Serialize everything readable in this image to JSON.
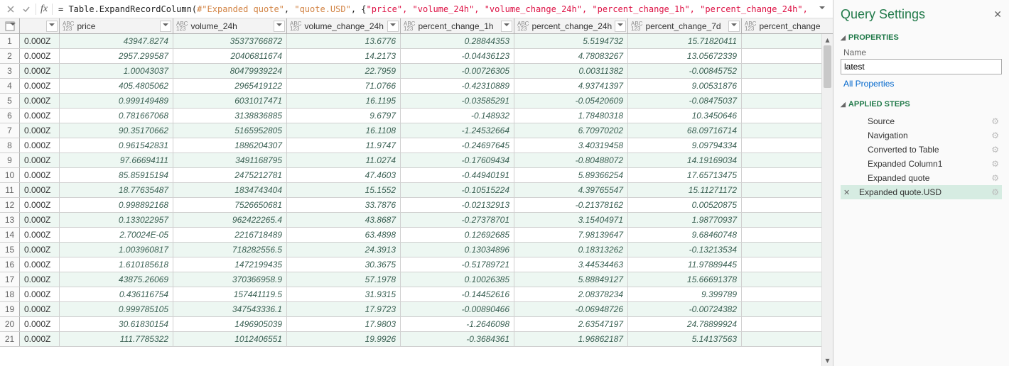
{
  "formula": {
    "prefix": "= Table.ExpandRecordColumn(",
    "arg1": "#\"Expanded quote\"",
    "sep1": ", ",
    "arg2": "\"quote.USD\"",
    "sep2": ", {",
    "cols": "\"price\", \"volume_24h\", \"volume_change_24h\", \"percent_change_1h\", \"percent_change_24h\","
  },
  "columns": {
    "price": "price",
    "volume_24h": "volume_24h",
    "volume_change_24h": "volume_change_24h",
    "percent_change_1h": "percent_change_1h",
    "percent_change_24h": "percent_change_24h",
    "percent_change_7d": "percent_change_7d",
    "percent_change_next": "percent_change"
  },
  "type_label_top": "ABC",
  "type_label_bot": "123",
  "rows": [
    {
      "c0": "0.000Z",
      "price": "43947.8274",
      "vol": "35373766872",
      "volchg": "13.6776",
      "pc1h": "0.28844353",
      "pc24h": "5.5194732",
      "pc7d": "15.71820411"
    },
    {
      "c0": "0.000Z",
      "price": "2957.299587",
      "vol": "20406811674",
      "volchg": "14.2173",
      "pc1h": "-0.04436123",
      "pc24h": "4.78083267",
      "pc7d": "13.05672339"
    },
    {
      "c0": "0.000Z",
      "price": "1.00043037",
      "vol": "80479939224",
      "volchg": "22.7959",
      "pc1h": "-0.00726305",
      "pc24h": "0.00311382",
      "pc7d": "-0.00845752"
    },
    {
      "c0": "0.000Z",
      "price": "405.4805062",
      "vol": "2965419122",
      "volchg": "71.0766",
      "pc1h": "-0.42310889",
      "pc24h": "4.93741397",
      "pc7d": "9.00531876"
    },
    {
      "c0": "0.000Z",
      "price": "0.999149489",
      "vol": "6031017471",
      "volchg": "16.1195",
      "pc1h": "-0.03585291",
      "pc24h": "-0.05420609",
      "pc7d": "-0.08475037"
    },
    {
      "c0": "0.000Z",
      "price": "0.781667068",
      "vol": "3138836885",
      "volchg": "9.6797",
      "pc1h": "-0.148932",
      "pc24h": "1.78480318",
      "pc7d": "10.3450646"
    },
    {
      "c0": "0.000Z",
      "price": "90.35170662",
      "vol": "5165952805",
      "volchg": "16.1108",
      "pc1h": "-1.24532664",
      "pc24h": "6.70970202",
      "pc7d": "68.09716714"
    },
    {
      "c0": "0.000Z",
      "price": "0.961542831",
      "vol": "1886204307",
      "volchg": "11.9747",
      "pc1h": "-0.24697645",
      "pc24h": "3.40319458",
      "pc7d": "9.09794334"
    },
    {
      "c0": "0.000Z",
      "price": "97.66694111",
      "vol": "3491168795",
      "volchg": "11.0274",
      "pc1h": "-0.17609434",
      "pc24h": "-0.80488072",
      "pc7d": "14.19169034"
    },
    {
      "c0": "0.000Z",
      "price": "85.85915194",
      "vol": "2475212781",
      "volchg": "47.4603",
      "pc1h": "-0.44940191",
      "pc24h": "5.89366254",
      "pc7d": "17.65713475"
    },
    {
      "c0": "0.000Z",
      "price": "18.77635487",
      "vol": "1834743404",
      "volchg": "15.1552",
      "pc1h": "-0.10515224",
      "pc24h": "4.39765547",
      "pc7d": "15.11271172"
    },
    {
      "c0": "0.000Z",
      "price": "0.998892168",
      "vol": "7526650681",
      "volchg": "33.7876",
      "pc1h": "-0.02132913",
      "pc24h": "-0.21378162",
      "pc7d": "0.00520875"
    },
    {
      "c0": "0.000Z",
      "price": "0.133022957",
      "vol": "962422265.4",
      "volchg": "43.8687",
      "pc1h": "-0.27378701",
      "pc24h": "3.15404971",
      "pc7d": "1.98770937"
    },
    {
      "c0": "0.000Z",
      "price": "2.70024E-05",
      "vol": "2216718489",
      "volchg": "63.4898",
      "pc1h": "0.12692685",
      "pc24h": "7.98139647",
      "pc7d": "9.68460748"
    },
    {
      "c0": "0.000Z",
      "price": "1.003960817",
      "vol": "718282556.5",
      "volchg": "24.3913",
      "pc1h": "0.13034896",
      "pc24h": "0.18313262",
      "pc7d": "-0.13213534"
    },
    {
      "c0": "0.000Z",
      "price": "1.610185618",
      "vol": "1472199435",
      "volchg": "30.3675",
      "pc1h": "-0.51789721",
      "pc24h": "3.44534463",
      "pc7d": "11.97889445"
    },
    {
      "c0": "0.000Z",
      "price": "43875.26069",
      "vol": "370366958.9",
      "volchg": "57.1978",
      "pc1h": "0.10026385",
      "pc24h": "5.88849127",
      "pc7d": "15.66691378"
    },
    {
      "c0": "0.000Z",
      "price": "0.436116754",
      "vol": "157441119.5",
      "volchg": "31.9315",
      "pc1h": "-0.14452616",
      "pc24h": "2.08378234",
      "pc7d": "9.399789"
    },
    {
      "c0": "0.000Z",
      "price": "0.999785105",
      "vol": "347543336.1",
      "volchg": "17.9723",
      "pc1h": "-0.00890466",
      "pc24h": "-0.06948726",
      "pc7d": "-0.00724382"
    },
    {
      "c0": "0.000Z",
      "price": "30.61830154",
      "vol": "1496905039",
      "volchg": "17.9803",
      "pc1h": "-1.2646098",
      "pc24h": "2.63547197",
      "pc7d": "24.78899924"
    },
    {
      "c0": "0.000Z",
      "price": "111.7785322",
      "vol": "1012406551",
      "volchg": "19.9926",
      "pc1h": "-0.3684361",
      "pc24h": "1.96862187",
      "pc7d": "5.14137563"
    }
  ],
  "settings": {
    "title": "Query Settings",
    "properties": "PROPERTIES",
    "name_label": "Name",
    "name_value": "latest",
    "all_props": "All Properties",
    "applied_steps": "APPLIED STEPS",
    "steps": [
      {
        "label": "Source",
        "indented": true,
        "gear": true
      },
      {
        "label": "Navigation",
        "indented": true,
        "gear": true
      },
      {
        "label": "Converted to Table",
        "indented": true,
        "gear": true
      },
      {
        "label": "Expanded Column1",
        "indented": true,
        "gear": true
      },
      {
        "label": "Expanded quote",
        "indented": true,
        "gear": true
      },
      {
        "label": "Expanded quote.USD",
        "indented": false,
        "gear": true,
        "selected": true
      }
    ]
  }
}
